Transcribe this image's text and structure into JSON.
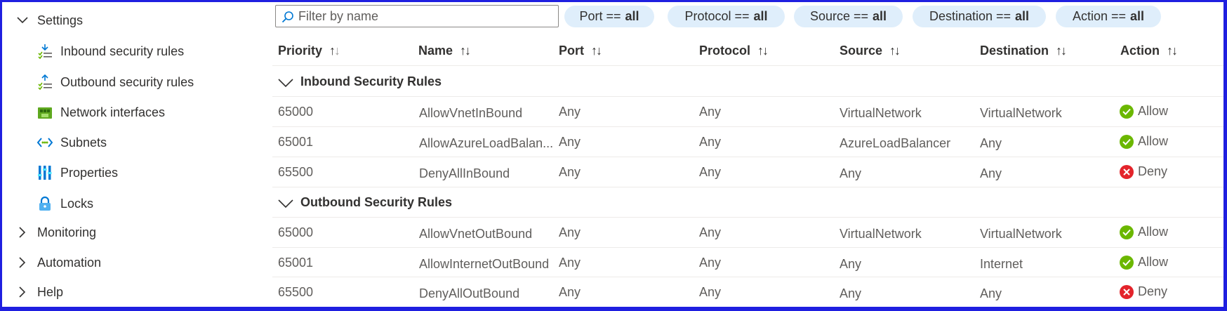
{
  "sidebar": {
    "settings_label": "Settings",
    "sub_items": [
      {
        "label": "Inbound security rules",
        "icon": "inbound-rules-icon"
      },
      {
        "label": "Outbound security rules",
        "icon": "outbound-rules-icon"
      },
      {
        "label": "Network interfaces",
        "icon": "network-interface-icon"
      },
      {
        "label": "Subnets",
        "icon": "subnet-icon"
      },
      {
        "label": "Properties",
        "icon": "properties-icon"
      },
      {
        "label": "Locks",
        "icon": "lock-icon"
      }
    ],
    "collapsed_items": [
      "Monitoring",
      "Automation",
      "Help"
    ]
  },
  "filter": {
    "placeholder": "Filter by name",
    "pills": [
      {
        "prefix": "Port ==",
        "value": "all"
      },
      {
        "prefix": "Protocol ==",
        "value": "all"
      },
      {
        "prefix": "Source ==",
        "value": "all"
      },
      {
        "prefix": "Destination ==",
        "value": "all"
      },
      {
        "prefix": "Action ==",
        "value": "all"
      }
    ]
  },
  "table": {
    "columns": [
      "Priority",
      "Name",
      "Port",
      "Protocol",
      "Source",
      "Destination",
      "Action"
    ],
    "groups": [
      {
        "label": "Inbound Security Rules",
        "rows": [
          {
            "priority": "65000",
            "name": "AllowVnetInBound",
            "port": "Any",
            "protocol": "Any",
            "source": "VirtualNetwork",
            "destination": "VirtualNetwork",
            "action": "Allow"
          },
          {
            "priority": "65001",
            "name": "AllowAzureLoadBalan...",
            "port": "Any",
            "protocol": "Any",
            "source": "AzureLoadBalancer",
            "destination": "Any",
            "action": "Allow"
          },
          {
            "priority": "65500",
            "name": "DenyAllInBound",
            "port": "Any",
            "protocol": "Any",
            "source": "Any",
            "destination": "Any",
            "action": "Deny"
          }
        ]
      },
      {
        "label": "Outbound Security Rules",
        "rows": [
          {
            "priority": "65000",
            "name": "AllowVnetOutBound",
            "port": "Any",
            "protocol": "Any",
            "source": "VirtualNetwork",
            "destination": "VirtualNetwork",
            "action": "Allow"
          },
          {
            "priority": "65001",
            "name": "AllowInternetOutBound",
            "port": "Any",
            "protocol": "Any",
            "source": "Any",
            "destination": "Internet",
            "action": "Allow"
          },
          {
            "priority": "65500",
            "name": "DenyAllOutBound",
            "port": "Any",
            "protocol": "Any",
            "source": "Any",
            "destination": "Any",
            "action": "Deny"
          }
        ]
      }
    ]
  },
  "colors": {
    "allow": "#6bb700",
    "deny": "#e3242b",
    "pill_bg": "#dfeefb",
    "frame": "#1f1fe0"
  }
}
